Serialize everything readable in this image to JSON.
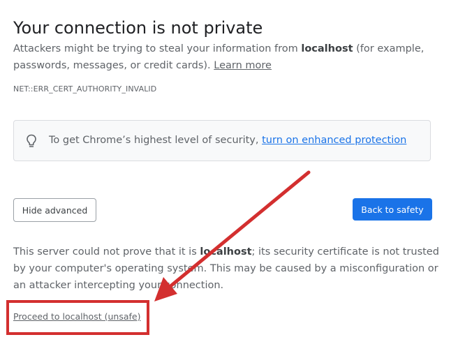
{
  "page": {
    "title": "Your connection is not private",
    "intro_prefix": "Attackers might be trying to steal your information from ",
    "intro_host": "localhost",
    "intro_suffix": " (for example, passwords, messages, or credit cards). ",
    "learn_more": "Learn more",
    "error_code": "NET::ERR_CERT_AUTHORITY_INVALID"
  },
  "promo": {
    "icon": "lightbulb-icon",
    "text": "To get Chrome’s highest level of security, ",
    "link": "turn on enhanced protection"
  },
  "buttons": {
    "hide_advanced": "Hide advanced",
    "back_to_safety": "Back to safety"
  },
  "details": {
    "prefix": "This server could not prove that it is ",
    "host": "localhost",
    "suffix": "; its security certificate is not trusted by your computer's operating system. This may be caused by a misconfiguration or an attacker intercepting your connection."
  },
  "proceed_link": "Proceed to localhost (unsafe)",
  "annotation": {
    "color": "#d32f2f"
  },
  "colors": {
    "primary_blue": "#1a73e8",
    "text_secondary": "#5f6368",
    "text_primary": "#202124"
  }
}
